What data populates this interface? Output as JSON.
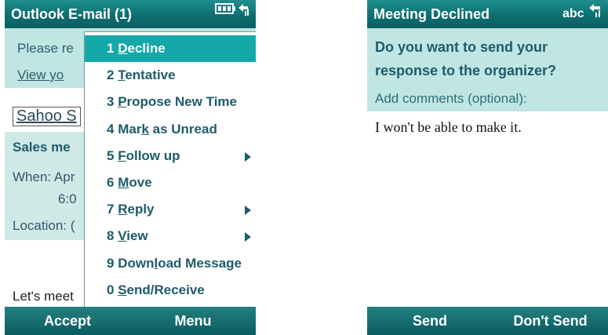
{
  "left": {
    "title": "Outlook E-mail (1)",
    "status_icon": "battery-signal-icon",
    "notice_line1": "Please re",
    "notice_line2": "View yo",
    "sender": "Sahoo S",
    "subject": "Sales me",
    "when_label": "When: Apr",
    "when_time": "6:0",
    "location": "Location: (",
    "body_text": "Let's meet",
    "menu": [
      {
        "num": "1",
        "pre": "",
        "ul": "D",
        "post": "ecline",
        "submenu": false,
        "selected": true
      },
      {
        "num": "2",
        "pre": "",
        "ul": "T",
        "post": "entative",
        "submenu": false,
        "selected": false
      },
      {
        "num": "3",
        "pre": "",
        "ul": "P",
        "post": "ropose New Time",
        "submenu": false,
        "selected": false
      },
      {
        "num": "4",
        "pre": "Mar",
        "ul": "k",
        "post": " as Unread",
        "submenu": false,
        "selected": false
      },
      {
        "num": "5",
        "pre": "",
        "ul": "F",
        "post": "ollow up",
        "submenu": true,
        "selected": false
      },
      {
        "num": "6",
        "pre": "",
        "ul": "M",
        "post": "ove",
        "submenu": false,
        "selected": false
      },
      {
        "num": "7",
        "pre": "",
        "ul": "R",
        "post": "eply",
        "submenu": true,
        "selected": false
      },
      {
        "num": "8",
        "pre": "",
        "ul": "V",
        "post": "iew",
        "submenu": true,
        "selected": false
      },
      {
        "num": "9",
        "pre": "Down",
        "ul": "l",
        "post": "oad Message",
        "submenu": false,
        "selected": false
      },
      {
        "num": "0",
        "pre": "",
        "ul": "S",
        "post": "end/Receive",
        "submenu": false,
        "selected": false
      }
    ],
    "softkey_left": "Accept",
    "softkey_right": "Menu"
  },
  "right": {
    "title": "Meeting Declined",
    "input_mode": "abc",
    "question_line1": "Do you want to send your",
    "question_line2": "response to the organizer?",
    "comments_label": "Add comments (optional):",
    "comment_text": "I won't be able to make it.",
    "softkey_left": "Send",
    "softkey_right": "Don't Send"
  },
  "colors": {
    "titlebar": "#0d6e70",
    "highlight": "#15a8a8",
    "panel": "#bfe6e3"
  }
}
